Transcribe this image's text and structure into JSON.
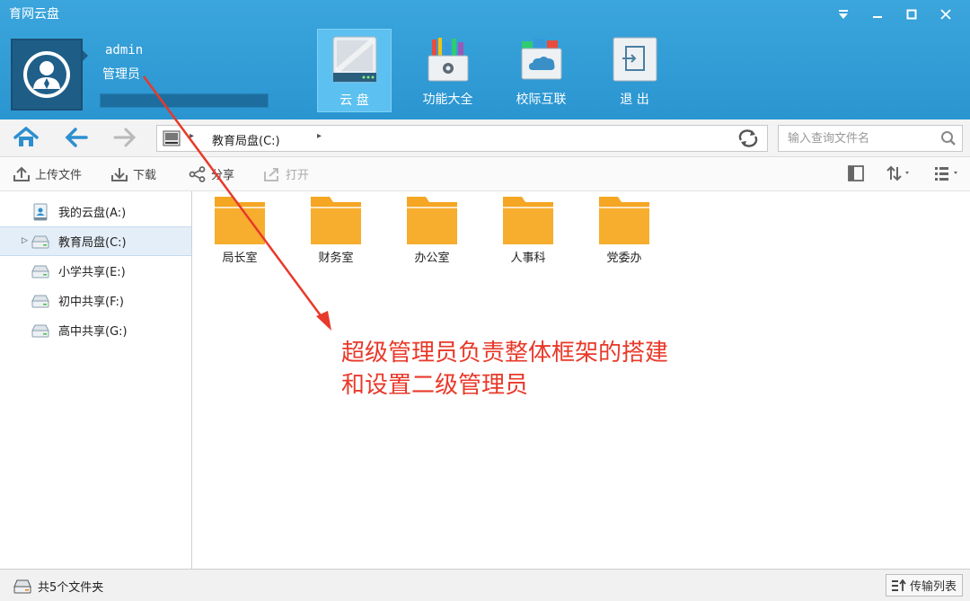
{
  "app": {
    "title": "育网云盘"
  },
  "user": {
    "name": "admin",
    "role": "管理员",
    "quota_fraction": 0.0
  },
  "nav_tabs": [
    {
      "label": "云 盘",
      "icon": "drive-icon",
      "active": true
    },
    {
      "label": "功能大全",
      "icon": "toolbox-icon",
      "active": false
    },
    {
      "label": "校际互联",
      "icon": "cloud-network-icon",
      "active": false
    },
    {
      "label": "退 出",
      "icon": "exit-icon",
      "active": false
    }
  ],
  "address": {
    "path": "教育局盘(C:)"
  },
  "search": {
    "placeholder": "输入查询文件名"
  },
  "actions": {
    "upload": "上传文件",
    "download": "下载",
    "share": "分享",
    "open": "打开"
  },
  "sidebar": {
    "items": [
      {
        "label": "我的云盘(A:)"
      },
      {
        "label": "教育局盘(C:)"
      },
      {
        "label": "小学共享(E:)"
      },
      {
        "label": "初中共享(F:)"
      },
      {
        "label": "高中共享(G:)"
      }
    ]
  },
  "folders": [
    {
      "label": "局长室"
    },
    {
      "label": "财务室"
    },
    {
      "label": "办公室"
    },
    {
      "label": "人事科"
    },
    {
      "label": "党委办"
    }
  ],
  "annotation": {
    "line1": "超级管理员负责整体框架的搭建",
    "line2": "和设置二级管理员"
  },
  "status": {
    "text": "共5个文件夹",
    "transfer_label": "传输列表"
  },
  "colors": {
    "header": "#2f9ad4",
    "folder": "#f5a623",
    "annotation": "#e8392a"
  }
}
